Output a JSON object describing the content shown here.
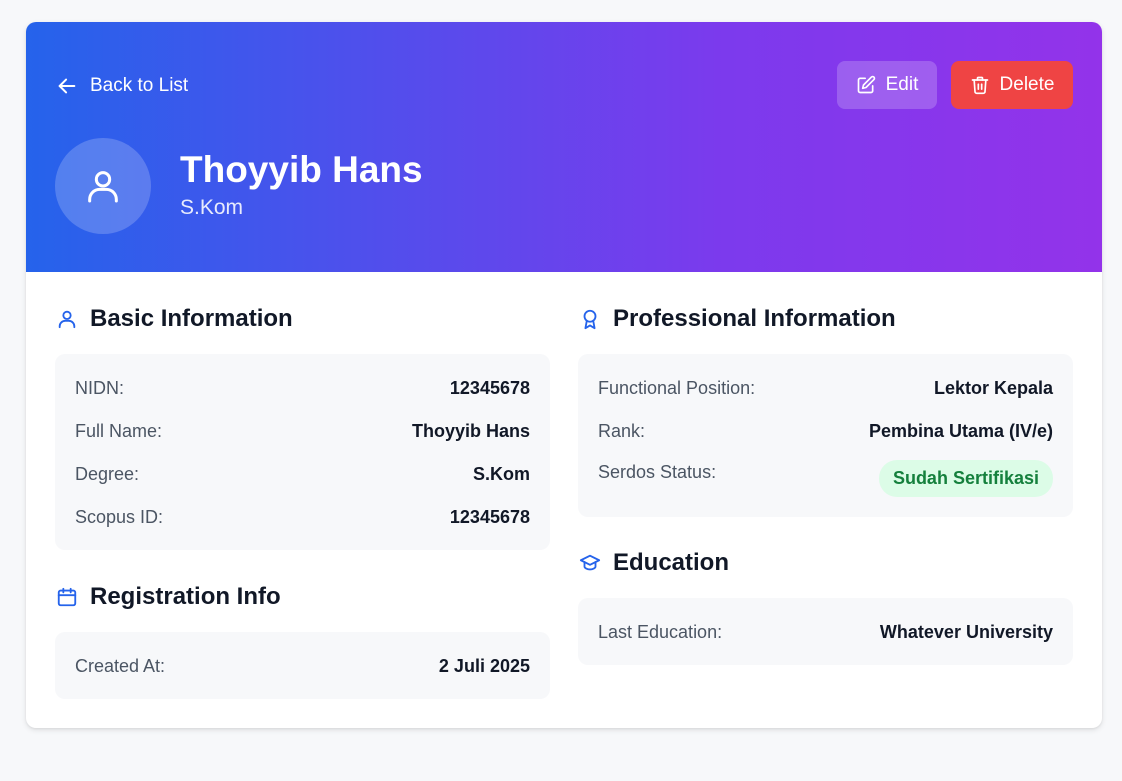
{
  "header": {
    "back_label": "Back to List",
    "edit_label": "Edit",
    "delete_label": "Delete",
    "name": "Thoyyib Hans",
    "degree": "S.Kom"
  },
  "basic_info": {
    "title": "Basic Information",
    "rows": [
      {
        "label": "NIDN:",
        "value": "12345678"
      },
      {
        "label": "Full Name:",
        "value": "Thoyyib Hans"
      },
      {
        "label": "Degree:",
        "value": "S.Kom"
      },
      {
        "label": "Scopus ID:",
        "value": "12345678"
      }
    ]
  },
  "registration": {
    "title": "Registration Info",
    "rows": [
      {
        "label": "Created At:",
        "value": "2 Juli 2025"
      }
    ]
  },
  "professional": {
    "title": "Professional Information",
    "rows": [
      {
        "label": "Functional Position:",
        "value": "Lektor Kepala"
      },
      {
        "label": "Rank:",
        "value": "Pembina Utama (IV/e)"
      },
      {
        "label": "Serdos Status:",
        "value": "Sudah Sertifikasi"
      }
    ]
  },
  "education": {
    "title": "Education",
    "rows": [
      {
        "label": "Last Education:",
        "value": "Whatever University"
      }
    ]
  },
  "colors": {
    "gradient_start": "#2563eb",
    "gradient_end": "#9333ea",
    "delete": "#ef4444",
    "accent_icon": "#2563eb",
    "badge_bg": "#dcfce7",
    "badge_text": "#15803d"
  },
  "icons": {
    "back": "arrow-left-icon",
    "edit": "edit-icon",
    "delete": "trash-icon",
    "avatar": "user-icon",
    "basic": "user-icon",
    "registration": "calendar-icon",
    "professional": "award-icon",
    "education": "graduation-cap-icon"
  }
}
